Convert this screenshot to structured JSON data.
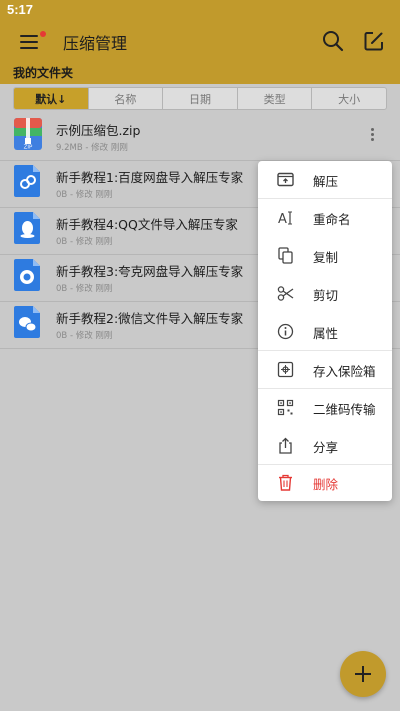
{
  "status_bar": {
    "time": "5:17"
  },
  "toolbar": {
    "title": "压缩管理",
    "menu_icon": "hamburger-icon",
    "search_icon": "search-icon",
    "edit_icon": "edit-icon"
  },
  "section": {
    "title": "我的文件夹"
  },
  "sort_tabs": [
    {
      "label": "默认↓",
      "active": true
    },
    {
      "label": "名称",
      "active": false
    },
    {
      "label": "日期",
      "active": false
    },
    {
      "label": "类型",
      "active": false
    },
    {
      "label": "大小",
      "active": false
    }
  ],
  "files": [
    {
      "name": "示例压缩包.zip",
      "meta": "9.2MB - 修改 刚刚",
      "icon": "zip-archive-icon"
    },
    {
      "name": "新手教程1:百度网盘导入解压专家",
      "meta": "0B - 修改 刚刚",
      "icon": "link-file-icon"
    },
    {
      "name": "新手教程4:QQ文件导入解压专家",
      "meta": "0B - 修改 刚刚",
      "icon": "qq-file-icon"
    },
    {
      "name": "新手教程3:夸克网盘导入解压专家",
      "meta": "0B - 修改 刚刚",
      "icon": "quark-file-icon"
    },
    {
      "name": "新手教程2:微信文件导入解压专家",
      "meta": "0B - 修改 刚刚",
      "icon": "wechat-file-icon"
    }
  ],
  "context_menu": {
    "items": [
      {
        "label": "解压",
        "icon": "extract-icon"
      },
      {
        "label": "重命名",
        "icon": "rename-icon"
      },
      {
        "label": "复制",
        "icon": "copy-icon"
      },
      {
        "label": "剪切",
        "icon": "scissors-icon"
      },
      {
        "label": "属性",
        "icon": "info-icon"
      },
      {
        "label": "存入保险箱",
        "icon": "safe-icon"
      },
      {
        "label": "二维码传输",
        "icon": "qr-code-icon"
      },
      {
        "label": "分享",
        "icon": "share-icon"
      },
      {
        "label": "删除",
        "icon": "trash-icon"
      }
    ]
  },
  "fab": {
    "icon": "plus-icon"
  },
  "colors": {
    "accent": "#c19a2c",
    "danger": "#e53935",
    "overlay_background": "#c9c9c9"
  }
}
